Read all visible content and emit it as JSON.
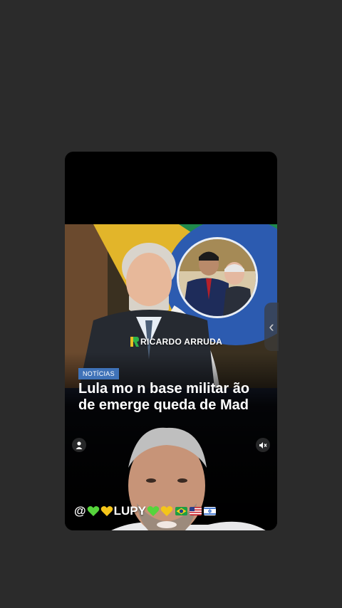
{
  "post": {
    "brand": "RICARDO ARRUDA",
    "tag": "NOTÍCIAS",
    "headline": "Lula mo           n base militar            ão de emerge            queda de Mad"
  },
  "caption": {
    "handle_prefix": "@",
    "name": "LUPY"
  },
  "icons": {
    "profile": "person-icon",
    "mute": "muted-speaker-icon",
    "next": "chevron-left-icon"
  },
  "colors": {
    "background": "#2b2b2b",
    "tag": "#3f72b8",
    "heart_green": "#56d43c",
    "heart_yellow": "#f4c51a"
  }
}
